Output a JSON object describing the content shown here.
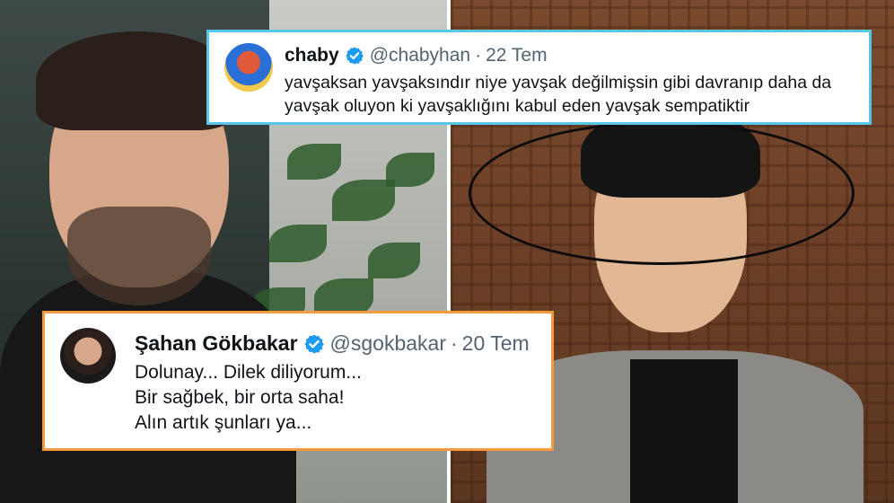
{
  "tweets": {
    "top": {
      "display_name": "chaby",
      "handle": "@chabyhan",
      "separator": "·",
      "date": "22 Tem",
      "lines": [
        "yavşaksan yavşaksındır niye yavşak değilmişsin gibi davranıp daha da",
        "yavşak oluyon ki yavşaklığını kabul eden yavşak sempatiktir"
      ],
      "border_color": "#58c6e6",
      "icon": "verified-badge-icon"
    },
    "bottom": {
      "display_name": "Şahan Gökbakar",
      "handle": "@sgokbakar",
      "separator": "·",
      "date": "20 Tem",
      "lines": [
        "Dolunay... Dilek diliyorum...",
        "Bir sağbek, bir orta saha!",
        "Alın artık şunları ya..."
      ],
      "border_color": "#f39a3e",
      "icon": "verified-badge-icon"
    }
  },
  "colors": {
    "verified_blue": "#1d9bf0",
    "text_primary": "#0f1419",
    "text_secondary": "#536471"
  }
}
